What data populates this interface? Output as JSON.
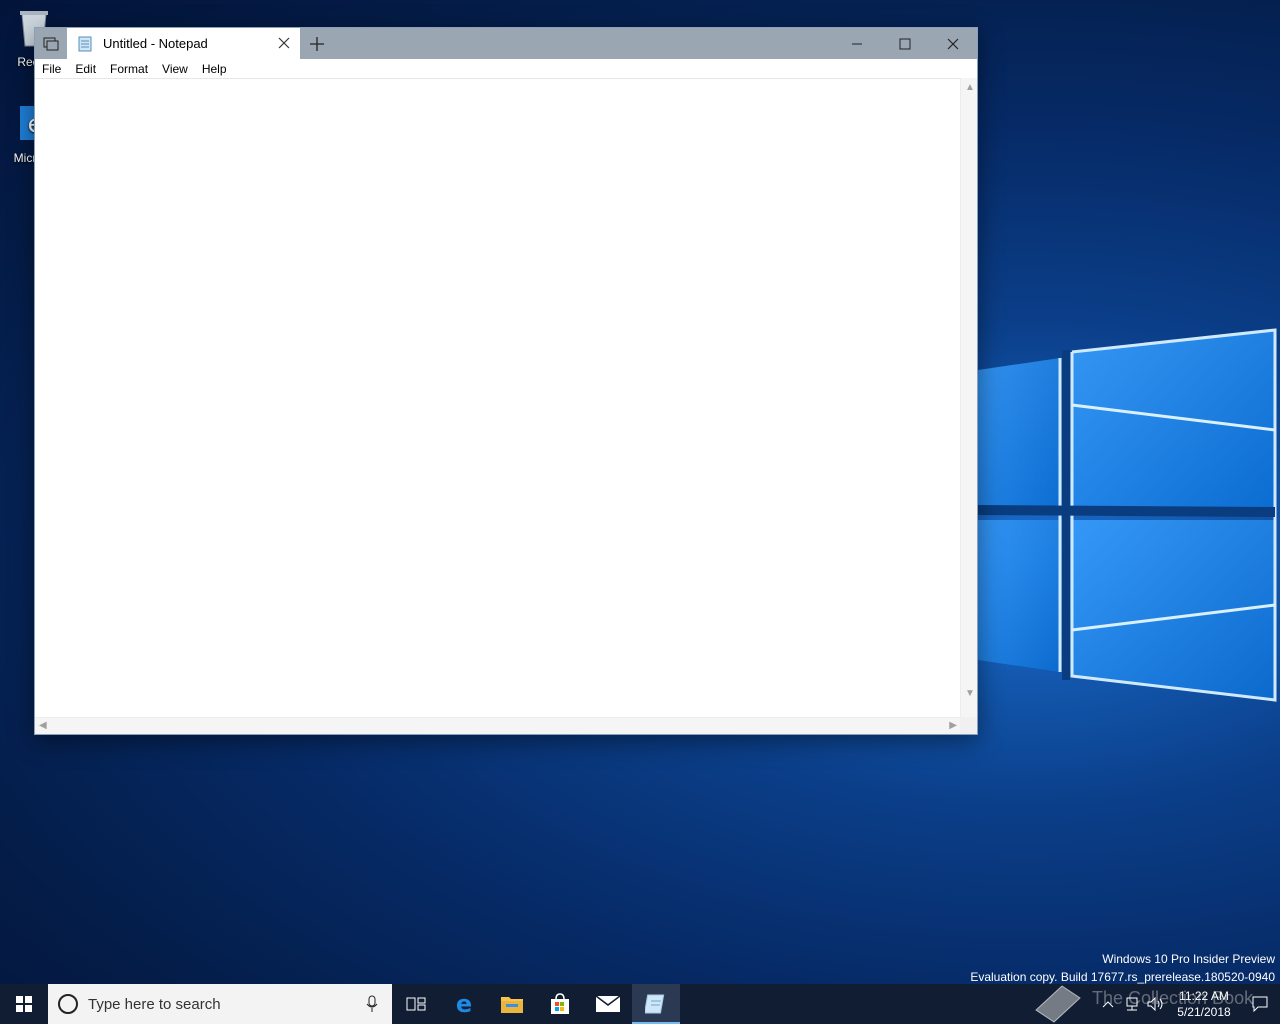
{
  "desktop": {
    "icons": [
      {
        "label": "Recyc"
      },
      {
        "label": "Micr Ed"
      }
    ],
    "watermark": {
      "line1": "Windows 10 Pro Insider Preview",
      "line2": "Evaluation copy. Build 17677.rs_prerelease.180520-0940"
    },
    "overlay_text": "The Collection Book"
  },
  "notepad": {
    "tab_title": "Untitled - Notepad",
    "menu": [
      "File",
      "Edit",
      "Format",
      "View",
      "Help"
    ],
    "content": ""
  },
  "taskbar": {
    "search_placeholder": "Type here to search",
    "clock_time": "11:22 AM",
    "clock_date": "5/21/2018",
    "apps": [
      "task-view",
      "edge",
      "file-explorer",
      "store",
      "mail",
      "notepad"
    ]
  },
  "colors": {
    "titlebar": "#9aa7b2",
    "taskbar": "#101d33",
    "accent": "#76b9ed"
  }
}
